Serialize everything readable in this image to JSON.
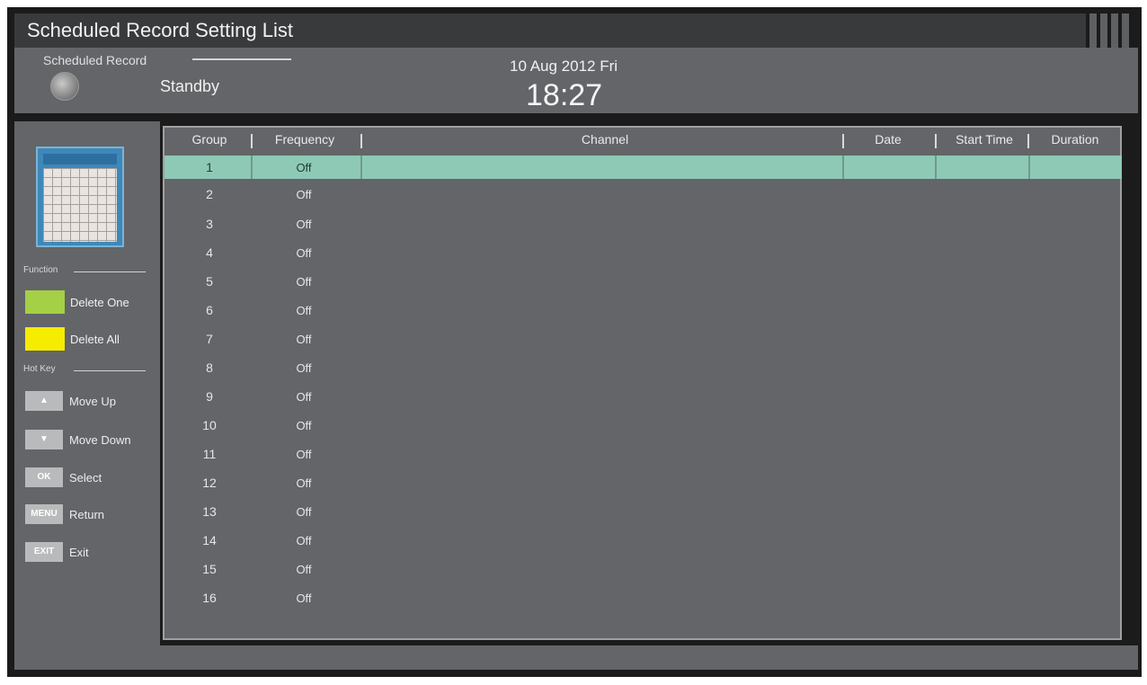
{
  "window": {
    "title": "Scheduled Record Setting List"
  },
  "header": {
    "label": "Scheduled Record",
    "status": "Standby",
    "date": "10 Aug 2012 Fri",
    "time": "18:27"
  },
  "sidebar": {
    "function_label": "Function",
    "function_keys": [
      {
        "label": "Delete One",
        "color": "#a4d045"
      },
      {
        "label": "Delete All",
        "color": "#f6ec00"
      }
    ],
    "hotkey_label": "Hot Key",
    "hotkeys": [
      {
        "key": "▲",
        "label": "Move Up"
      },
      {
        "key": "▼",
        "label": "Move Down"
      },
      {
        "key": "OK",
        "label": "Select"
      },
      {
        "key": "MENU",
        "label": "Return"
      },
      {
        "key": "EXIT",
        "label": "Exit"
      }
    ]
  },
  "table": {
    "columns": [
      "Group",
      "Frequency",
      "Channel",
      "Date",
      "Start Time",
      "Duration"
    ],
    "selected_index": 0,
    "rows": [
      {
        "group": "1",
        "frequency": "Off"
      },
      {
        "group": "2",
        "frequency": "Off"
      },
      {
        "group": "3",
        "frequency": "Off"
      },
      {
        "group": "4",
        "frequency": "Off"
      },
      {
        "group": "5",
        "frequency": "Off"
      },
      {
        "group": "6",
        "frequency": "Off"
      },
      {
        "group": "7",
        "frequency": "Off"
      },
      {
        "group": "8",
        "frequency": "Off"
      },
      {
        "group": "9",
        "frequency": "Off"
      },
      {
        "group": "10",
        "frequency": "Off"
      },
      {
        "group": "11",
        "frequency": "Off"
      },
      {
        "group": "12",
        "frequency": "Off"
      },
      {
        "group": "13",
        "frequency": "Off"
      },
      {
        "group": "14",
        "frequency": "Off"
      },
      {
        "group": "15",
        "frequency": "Off"
      },
      {
        "group": "16",
        "frequency": "Off"
      }
    ]
  },
  "colors": {
    "selection": "#8ec9b6",
    "panel": "#636568",
    "frame": "#1b1b1b"
  }
}
